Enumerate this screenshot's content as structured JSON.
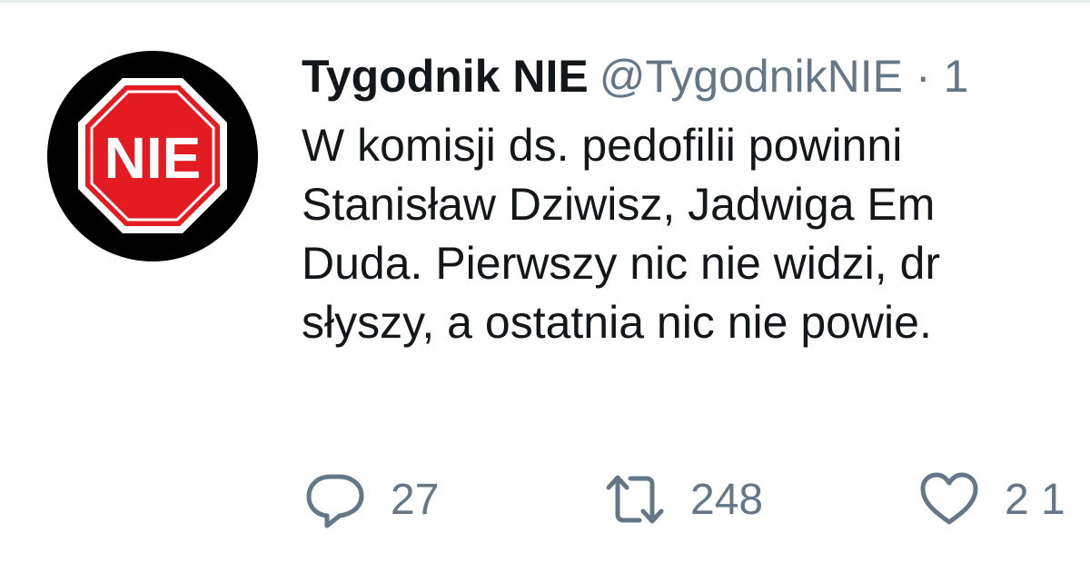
{
  "tweet": {
    "author": {
      "display_name": "Tygodnik NIE",
      "handle": "@TygodnikNIE",
      "separator": "·",
      "date_partial": "1",
      "avatar_text": "NIE"
    },
    "text_lines": [
      "W komisji ds. pedofilii powinni",
      "Stanisław Dziwisz, Jadwiga Em",
      "Duda. Pierwszy nic nie widzi, dr",
      "słyszy, a ostatnia nic nie powie."
    ],
    "actions": {
      "reply": {
        "icon": "reply-icon",
        "count": "27"
      },
      "retweet": {
        "icon": "retweet-icon",
        "count": "248"
      },
      "like": {
        "icon": "heart-icon",
        "count": "2 1"
      }
    }
  },
  "colors": {
    "text_primary": "#14171a",
    "text_secondary": "#657786",
    "avatar_bg": "#000000",
    "stop_sign_red": "#e31b23",
    "stop_sign_border": "#ffffff"
  }
}
